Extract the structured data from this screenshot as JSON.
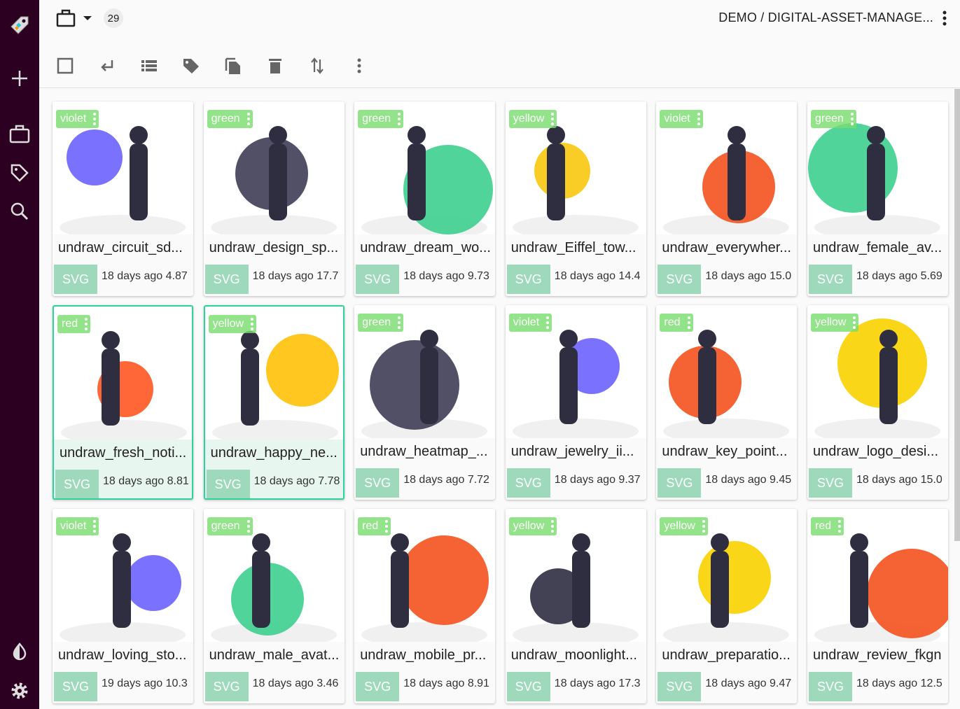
{
  "sidebar": {
    "items": [
      {
        "name": "add",
        "icon": "plus-icon"
      },
      {
        "name": "collections",
        "icon": "briefcase-icon"
      },
      {
        "name": "tags",
        "icon": "tag-icon"
      },
      {
        "name": "search",
        "icon": "search-icon"
      },
      {
        "name": "theme",
        "icon": "contrast-icon"
      },
      {
        "name": "settings",
        "icon": "gear-icon"
      }
    ]
  },
  "header": {
    "count": "29",
    "breadcrumb": "DEMO /  DIGITAL-ASSET-MANAGE..."
  },
  "toolbar": [
    "select-all",
    "enter",
    "list-view",
    "tag",
    "copy",
    "delete",
    "sort",
    "more"
  ],
  "colors": {
    "accent": "#2fd29e",
    "sidebar": "#2b0020",
    "format_badge": "#9ed9bc"
  },
  "cards": [
    {
      "title": "undraw_circuit_sd...",
      "tag": "violet",
      "format": "SVG",
      "meta": "18 days ago 4.87",
      "selected": false,
      "art": "#6c63ff"
    },
    {
      "title": "undraw_design_sp...",
      "tag": "green",
      "format": "SVG",
      "meta": "18 days ago 17.7",
      "selected": false,
      "art": "#3f3d56"
    },
    {
      "title": "undraw_dream_wo...",
      "tag": "green",
      "format": "SVG",
      "meta": "18 days ago 9.73",
      "selected": false,
      "art": "#3ecf8e"
    },
    {
      "title": "undraw_Eiffel_tow...",
      "tag": "yellow",
      "format": "SVG",
      "meta": "18 days ago 14.4",
      "selected": false,
      "art": "#f9c80e"
    },
    {
      "title": "undraw_everywher...",
      "tag": "violet",
      "format": "SVG",
      "meta": "18 days ago 15.0",
      "selected": false,
      "art": "#f4511e"
    },
    {
      "title": "undraw_female_av...",
      "tag": "green",
      "format": "SVG",
      "meta": "18 days ago 5.69",
      "selected": false,
      "art": "#3ecf8e"
    },
    {
      "title": "undraw_fresh_noti...",
      "tag": "red",
      "format": "SVG",
      "meta": "18 days ago 8.81",
      "selected": true,
      "art": "#ff5722"
    },
    {
      "title": "undraw_happy_ne...",
      "tag": "yellow",
      "format": "SVG",
      "meta": "18 days ago 7.78",
      "selected": true,
      "art": "#ffc107"
    },
    {
      "title": "undraw_heatmap_...",
      "tag": "green",
      "format": "SVG",
      "meta": "18 days ago 7.72",
      "selected": false,
      "art": "#3f3d56"
    },
    {
      "title": "undraw_jewelry_ii...",
      "tag": "violet",
      "format": "SVG",
      "meta": "18 days ago 9.37",
      "selected": false,
      "art": "#6c63ff"
    },
    {
      "title": "undraw_key_point...",
      "tag": "red",
      "format": "SVG",
      "meta": "18 days ago 9.45",
      "selected": false,
      "art": "#f4511e"
    },
    {
      "title": "undraw_logo_desi...",
      "tag": "yellow",
      "format": "SVG",
      "meta": "18 days ago 15.0",
      "selected": false,
      "art": "#f9d100"
    },
    {
      "title": "undraw_loving_sto...",
      "tag": "violet",
      "format": "SVG",
      "meta": "19 days ago 10.3",
      "selected": false,
      "art": "#6c63ff"
    },
    {
      "title": "undraw_male_avat...",
      "tag": "green",
      "format": "SVG",
      "meta": "18 days ago 3.46",
      "selected": false,
      "art": "#3ecf8e"
    },
    {
      "title": "undraw_mobile_pr...",
      "tag": "red",
      "format": "SVG",
      "meta": "18 days ago 8.91",
      "selected": false,
      "art": "#f4511e"
    },
    {
      "title": "undraw_moonlight...",
      "tag": "yellow",
      "format": "SVG",
      "meta": "18 days ago 17.3",
      "selected": false,
      "art": "#2f2e41"
    },
    {
      "title": "undraw_preparatio...",
      "tag": "yellow",
      "format": "SVG",
      "meta": "18 days ago 9.47",
      "selected": false,
      "art": "#f9d100"
    },
    {
      "title": "undraw_review_fkgn",
      "tag": "red",
      "format": "SVG",
      "meta": "18 days ago 12.5",
      "selected": false,
      "art": "#f4511e"
    }
  ]
}
